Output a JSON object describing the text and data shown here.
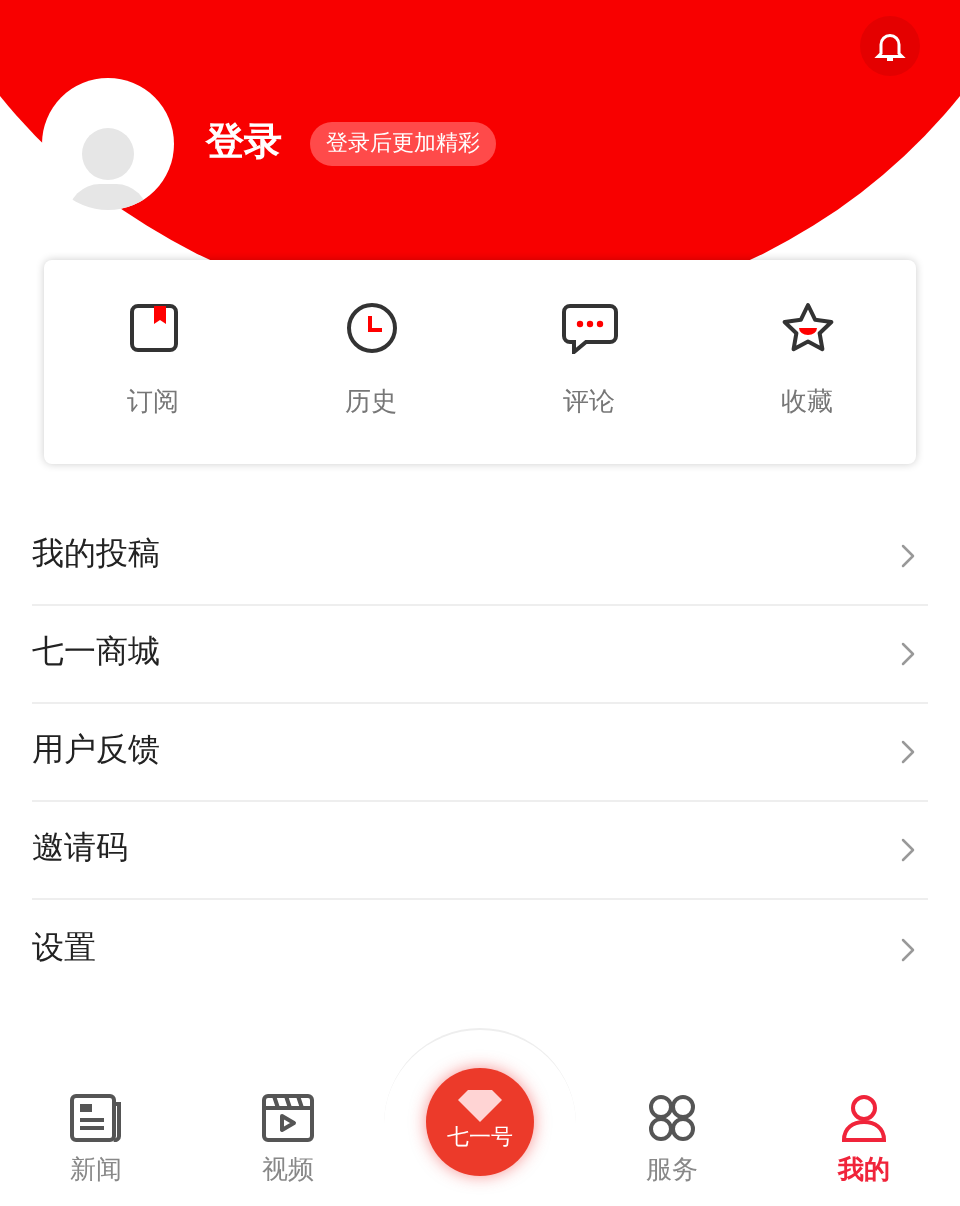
{
  "profile": {
    "login": "登录",
    "hint": "登录后更加精彩"
  },
  "shortcuts": [
    {
      "label": "订阅"
    },
    {
      "label": "历史"
    },
    {
      "label": "评论"
    },
    {
      "label": "收藏"
    }
  ],
  "menu": [
    {
      "label": "我的投稿"
    },
    {
      "label": "七一商城"
    },
    {
      "label": "用户反馈"
    },
    {
      "label": "邀请码"
    },
    {
      "label": "设置"
    }
  ],
  "tabs": [
    {
      "kind": "icon",
      "label": "新闻",
      "selected": false
    },
    {
      "kind": "icon",
      "label": "视频",
      "selected": false
    },
    {
      "kind": "center",
      "label": "七一号",
      "selected": false
    },
    {
      "kind": "icon",
      "label": "服务",
      "selected": false
    },
    {
      "kind": "icon",
      "label": "我的",
      "selected": true
    }
  ]
}
